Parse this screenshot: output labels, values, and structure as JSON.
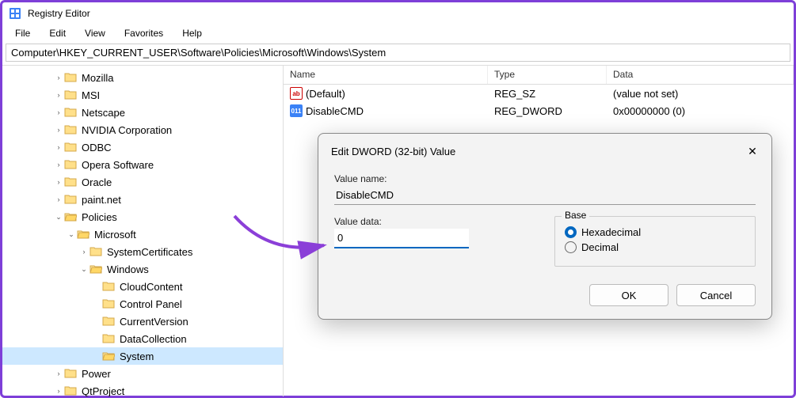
{
  "window": {
    "title": "Registry Editor"
  },
  "menu": {
    "items": [
      "File",
      "Edit",
      "View",
      "Favorites",
      "Help"
    ]
  },
  "address": "Computer\\HKEY_CURRENT_USER\\Software\\Policies\\Microsoft\\Windows\\System",
  "tree": [
    {
      "indent": 4,
      "chev": ">",
      "label": "Mozilla"
    },
    {
      "indent": 4,
      "chev": ">",
      "label": "MSI"
    },
    {
      "indent": 4,
      "chev": ">",
      "label": "Netscape"
    },
    {
      "indent": 4,
      "chev": ">",
      "label": "NVIDIA Corporation"
    },
    {
      "indent": 4,
      "chev": ">",
      "label": "ODBC"
    },
    {
      "indent": 4,
      "chev": ">",
      "label": "Opera Software"
    },
    {
      "indent": 4,
      "chev": ">",
      "label": "Oracle"
    },
    {
      "indent": 4,
      "chev": ">",
      "label": "paint.net"
    },
    {
      "indent": 4,
      "chev": "v",
      "label": "Policies",
      "open": true
    },
    {
      "indent": 5,
      "chev": "v",
      "label": "Microsoft",
      "open": true
    },
    {
      "indent": 6,
      "chev": ">",
      "label": "SystemCertificates"
    },
    {
      "indent": 6,
      "chev": "v",
      "label": "Windows",
      "open": true
    },
    {
      "indent": 7,
      "chev": "",
      "label": "CloudContent"
    },
    {
      "indent": 7,
      "chev": "",
      "label": "Control Panel"
    },
    {
      "indent": 7,
      "chev": "",
      "label": "CurrentVersion"
    },
    {
      "indent": 7,
      "chev": "",
      "label": "DataCollection"
    },
    {
      "indent": 7,
      "chev": "",
      "label": "System",
      "selected": true
    },
    {
      "indent": 4,
      "chev": ">",
      "label": "Power"
    },
    {
      "indent": 4,
      "chev": ">",
      "label": "QtProject"
    }
  ],
  "list": {
    "headers": {
      "name": "Name",
      "type": "Type",
      "data": "Data"
    },
    "rows": [
      {
        "icon": "sz",
        "iconText": "ab",
        "name": "(Default)",
        "type": "REG_SZ",
        "data": "(value not set)"
      },
      {
        "icon": "dw",
        "iconText": "011",
        "name": "DisableCMD",
        "type": "REG_DWORD",
        "data": "0x00000000 (0)"
      }
    ]
  },
  "dialog": {
    "title": "Edit DWORD (32-bit) Value",
    "valueNameLabel": "Value name:",
    "valueName": "DisableCMD",
    "valueDataLabel": "Value data:",
    "valueData": "0",
    "baseLabel": "Base",
    "hexLabel": "Hexadecimal",
    "decLabel": "Decimal",
    "ok": "OK",
    "cancel": "Cancel"
  }
}
